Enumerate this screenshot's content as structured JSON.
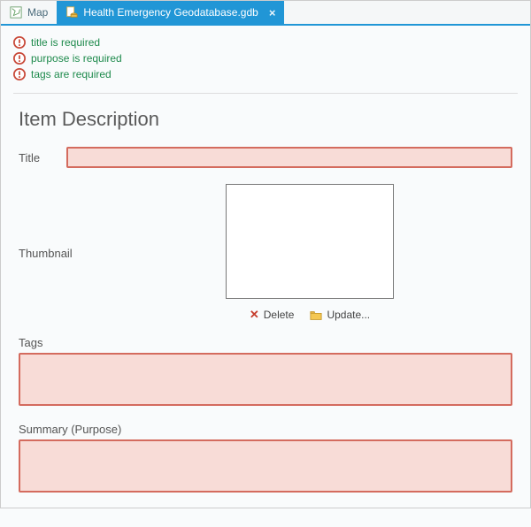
{
  "tabs": {
    "map": {
      "label": "Map"
    },
    "gdb": {
      "label": "Health Emergency Geodatabase.gdb"
    }
  },
  "messages": {
    "title_req": "title is required",
    "purpose_req": "purpose is required",
    "tags_req": "tags are required"
  },
  "section": {
    "heading": "Item Description",
    "title_label": "Title",
    "title_value": "",
    "thumbnail_label": "Thumbnail",
    "delete_label": "Delete",
    "update_label": "Update...",
    "tags_label": "Tags",
    "tags_value": "",
    "summary_label": "Summary (Purpose)",
    "summary_value": ""
  }
}
